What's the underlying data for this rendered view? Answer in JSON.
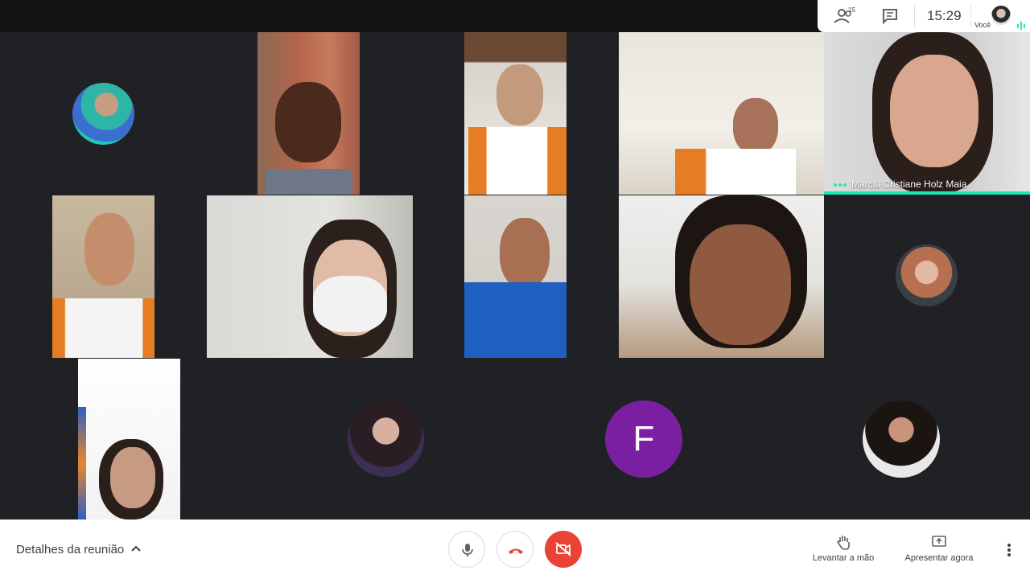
{
  "top_panel": {
    "participant_count": "15",
    "time": "15:29",
    "self_label": "Você",
    "icons": [
      "people-icon",
      "chat-icon",
      "self-avatar",
      "audio-level-icon"
    ]
  },
  "tiles": {
    "featured_name": "Marcia Cristiane Holz Maia",
    "letter_avatar": "F"
  },
  "bottom_bar": {
    "details_label": "Detalhes da reunião",
    "raise_hand_label": "Levantar a mão",
    "present_label": "Apresentar agora"
  },
  "colors": {
    "background": "#202124",
    "letter_avatar": "#7b1fa2",
    "end_call_red": "#ea4335",
    "camera_off_red": "#ea4335",
    "accent_teal": "#1de9b6"
  }
}
